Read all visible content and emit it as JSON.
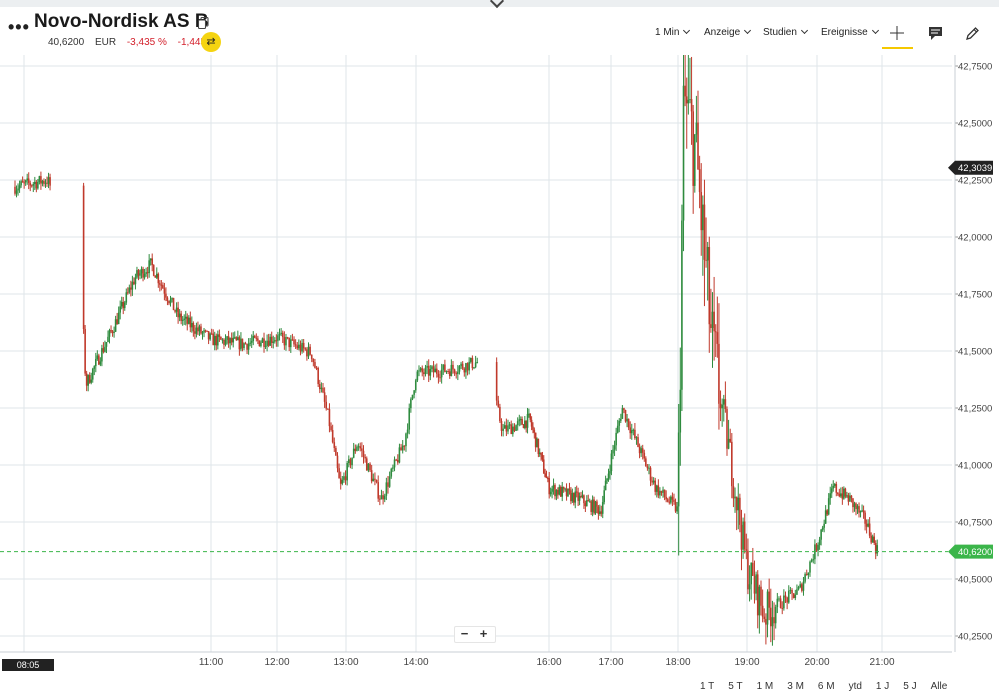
{
  "header": {
    "title": "Novo-Nordisk AS B",
    "price": "40,6200",
    "currency": "EUR",
    "change_pct": "-3,435 %",
    "change_abs": "-1,4450"
  },
  "toolbar": {
    "interval": "1 Min",
    "view": "Anzeige",
    "studies": "Studien",
    "events": "Ereignisse"
  },
  "zoom": {
    "minus": "−",
    "plus": "+"
  },
  "ranges": [
    "1 T",
    "5 T",
    "1 M",
    "3 M",
    "6 M",
    "ytd",
    "1 J",
    "5 J",
    "Alle"
  ],
  "colors": {
    "up": "#2e8b3e",
    "down": "#c0392b",
    "accent": "#f5c800",
    "current": "#3bb54a",
    "marker_bg": "#222222"
  },
  "chart_data": {
    "type": "candlestick",
    "y_axis_side": "right",
    "y_ticks": [
      "42,7500",
      "42,5000",
      "42,2500",
      "42,0000",
      "41,7500",
      "41,5000",
      "41,2500",
      "41,0000",
      "40,7500",
      "40,5000",
      "40,2500"
    ],
    "y_tick_values": [
      42.75,
      42.5,
      42.25,
      42.0,
      41.75,
      41.5,
      41.25,
      41.0,
      40.75,
      40.5,
      40.25
    ],
    "x_ticks": [
      "11:00",
      "12:00",
      "13:00",
      "14:00",
      "16:00",
      "17:00",
      "18:00",
      "19:00",
      "20:00",
      "21:00"
    ],
    "x_tick_hours": [
      11,
      12,
      13,
      14,
      16,
      17,
      18,
      19,
      20,
      21
    ],
    "crosshair_time_label": "08:05",
    "current_price": 40.62,
    "current_price_label": "40,6200",
    "marker_price": 42.3039,
    "marker_price_label": "42,3039",
    "series": [
      {
        "time": "08:00",
        "price": 42.22
      },
      {
        "time": "08:30",
        "price": 42.25
      },
      {
        "time": "09:00",
        "price": 41.9
      },
      {
        "time": "09:05",
        "price": 41.35
      },
      {
        "time": "09:30",
        "price": 41.6
      },
      {
        "time": "09:50",
        "price": 41.82
      },
      {
        "time": "10:05",
        "price": 41.88
      },
      {
        "time": "10:30",
        "price": 41.65
      },
      {
        "time": "11:00",
        "price": 41.55
      },
      {
        "time": "11:30",
        "price": 41.53
      },
      {
        "time": "12:00",
        "price": 41.56
      },
      {
        "time": "12:30",
        "price": 41.49
      },
      {
        "time": "12:45",
        "price": 41.2
      },
      {
        "time": "12:55",
        "price": 40.9
      },
      {
        "time": "13:10",
        "price": 41.1
      },
      {
        "time": "13:30",
        "price": 40.85
      },
      {
        "time": "13:50",
        "price": 41.1
      },
      {
        "time": "14:00",
        "price": 41.4
      },
      {
        "time": "14:30",
        "price": 41.42
      },
      {
        "time": "15:00",
        "price": 41.46
      },
      {
        "time": "15:15",
        "price": 41.15
      },
      {
        "time": "15:40",
        "price": 41.2
      },
      {
        "time": "16:00",
        "price": 40.9
      },
      {
        "time": "16:30",
        "price": 40.85
      },
      {
        "time": "16:50",
        "price": 40.8
      },
      {
        "time": "17:10",
        "price": 41.25
      },
      {
        "time": "17:40",
        "price": 40.9
      },
      {
        "time": "18:00",
        "price": 40.8
      },
      {
        "time": "18:05",
        "price": 42.6
      },
      {
        "time": "18:15",
        "price": 42.4
      },
      {
        "time": "18:30",
        "price": 41.5
      },
      {
        "time": "18:45",
        "price": 41.05
      },
      {
        "time": "19:00",
        "price": 40.55
      },
      {
        "time": "19:15",
        "price": 40.35
      },
      {
        "time": "19:45",
        "price": 40.45
      },
      {
        "time": "20:00",
        "price": 40.65
      },
      {
        "time": "20:15",
        "price": 40.9
      },
      {
        "time": "20:30",
        "price": 40.85
      },
      {
        "time": "20:45",
        "price": 40.75
      },
      {
        "time": "20:55",
        "price": 40.63
      }
    ]
  }
}
